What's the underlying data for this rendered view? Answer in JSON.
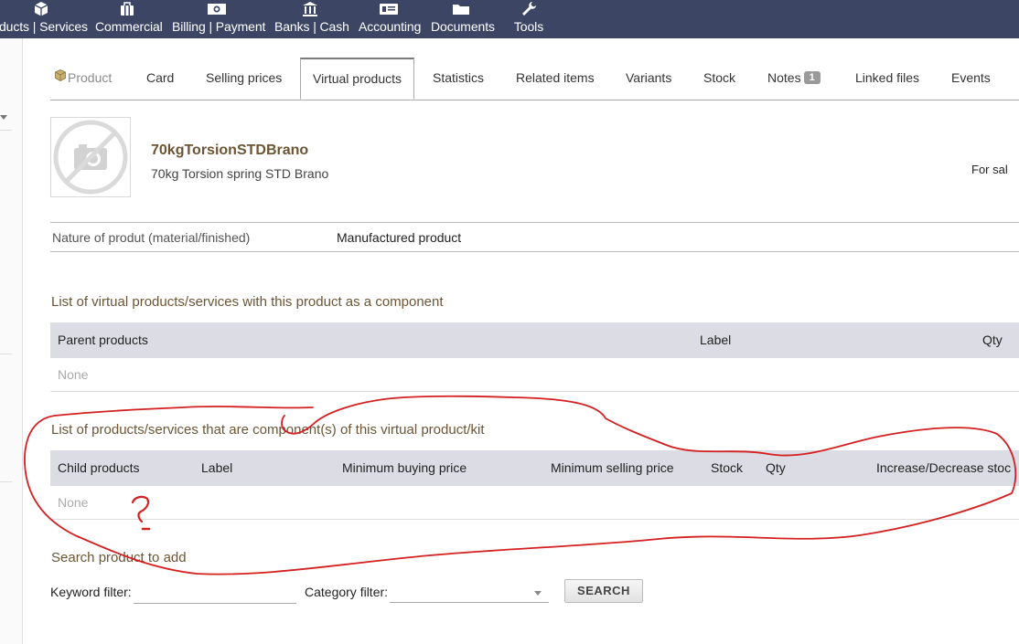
{
  "nav": {
    "items": [
      {
        "label": "ducts | Services",
        "icon": "box-icon"
      },
      {
        "label": "Commercial",
        "icon": "briefcase-icon"
      },
      {
        "label": "Billing | Payment",
        "icon": "money-icon"
      },
      {
        "label": "Banks | Cash",
        "icon": "bank-icon"
      },
      {
        "label": "Accounting",
        "icon": "ledger-icon"
      },
      {
        "label": "Documents",
        "icon": "folder-icon"
      },
      {
        "label": "Tools",
        "icon": "wrench-icon"
      }
    ]
  },
  "tabs": [
    {
      "label": "Product"
    },
    {
      "label": "Card"
    },
    {
      "label": "Selling prices"
    },
    {
      "label": "Virtual products"
    },
    {
      "label": "Statistics"
    },
    {
      "label": "Related items"
    },
    {
      "label": "Variants"
    },
    {
      "label": "Stock"
    },
    {
      "label": "Notes",
      "badge": "1"
    },
    {
      "label": "Linked files"
    },
    {
      "label": "Events"
    }
  ],
  "product": {
    "ref": "70kgTorsionSTDBrano",
    "label": "70kg Torsion spring STD Brano",
    "status": "For sal",
    "photo_icon": "no-photo-icon"
  },
  "nature": {
    "key": "Nature of produt (material/finished)",
    "value": "Manufactured product"
  },
  "parents": {
    "title": "List of virtual products/services with this product as a component",
    "columns": [
      "Parent products",
      "Label",
      "Qty"
    ],
    "empty": "None"
  },
  "children": {
    "title": "List of products/services that are component(s) of this virtual product/kit",
    "columns": [
      "Child products",
      "Label",
      "Minimum buying price",
      "Minimum selling price",
      "Stock",
      "Qty",
      "Increase/Decrease stoc"
    ],
    "empty": "None"
  },
  "search": {
    "title": "Search product to add",
    "keyword_label": "Keyword filter:",
    "keyword_value": "",
    "category_label": "Category filter:",
    "category_value": "",
    "button": "SEARCH"
  },
  "annotation": {
    "color": "#d42020",
    "mark": "?"
  },
  "colors": {
    "nav_bg": "#3c4664",
    "heading": "#6b5535",
    "table_head_bg": "#dcdce4"
  }
}
